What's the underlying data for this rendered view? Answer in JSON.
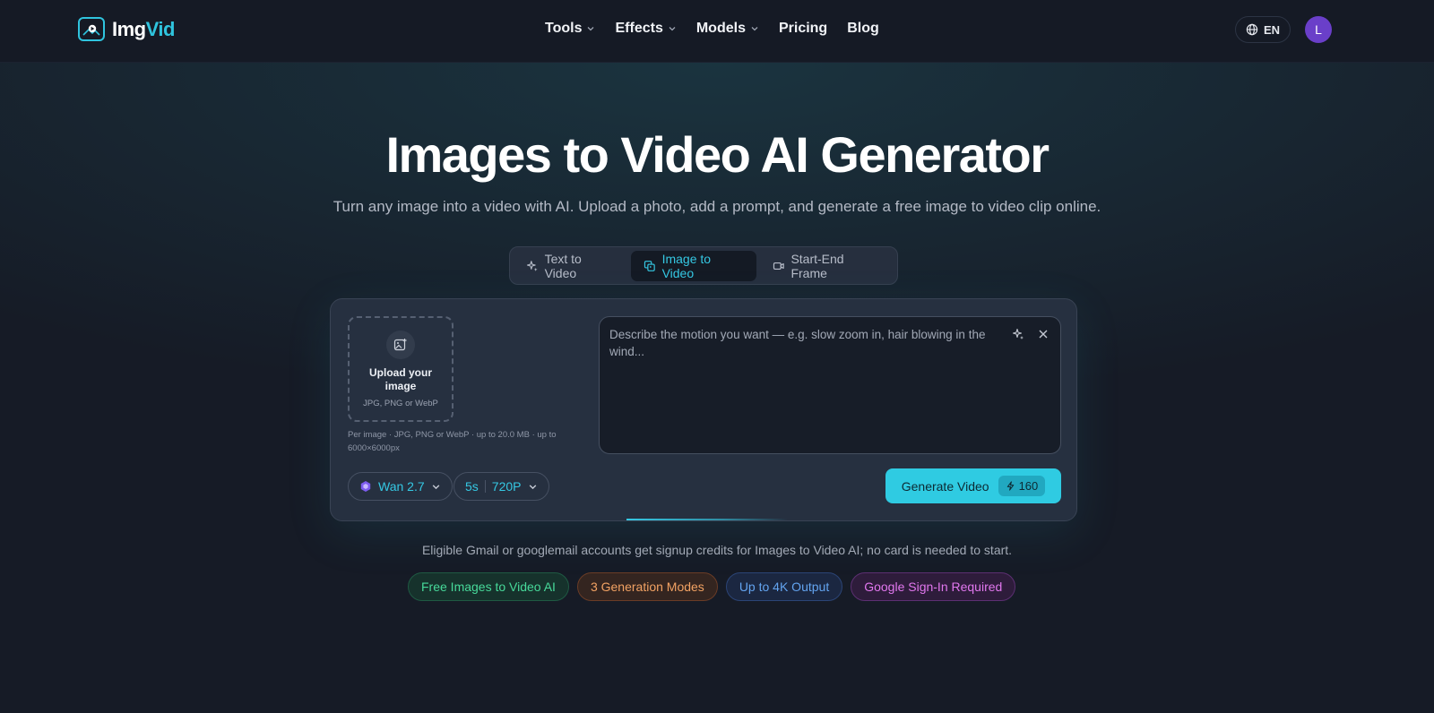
{
  "brand": {
    "name_part1": "Img",
    "name_part2": "Vid",
    "accent": "#2fc4de"
  },
  "nav": {
    "items": [
      {
        "label": "Tools",
        "has_dropdown": true
      },
      {
        "label": "Effects",
        "has_dropdown": true
      },
      {
        "label": "Models",
        "has_dropdown": true
      },
      {
        "label": "Pricing",
        "has_dropdown": false
      },
      {
        "label": "Blog",
        "has_dropdown": false
      }
    ],
    "language": "EN",
    "avatar_initial": "L"
  },
  "hero": {
    "title": "Images to Video AI Generator",
    "subtitle": "Turn any image into a video with AI. Upload a photo, add a prompt, and generate a free image to video clip online."
  },
  "modes": [
    {
      "label": "Text to Video",
      "icon": "sparkles-icon",
      "active": false
    },
    {
      "label": "Image to Video",
      "icon": "images-icon",
      "active": true
    },
    {
      "label": "Start-End Frame",
      "icon": "video-camera-icon",
      "active": false
    }
  ],
  "upload": {
    "title": "Upload your image",
    "formats": "JPG, PNG or WebP",
    "note": "Per image · JPG, PNG or WebP · up to 20.0 MB · up to 6000×6000px"
  },
  "prompt": {
    "placeholder": "Describe the motion you want — e.g. slow zoom in, hair blowing in the wind..."
  },
  "model_select": {
    "value": "Wan 2.7"
  },
  "settings_select": {
    "duration": "5s",
    "resolution": "720P"
  },
  "generate": {
    "label": "Generate Video",
    "credits": "160"
  },
  "notice": "Eligible Gmail or googlemail accounts get signup credits for Images to Video AI; no card is needed to start.",
  "badges": [
    {
      "label": "Free Images to Video AI",
      "color": "#47d99a"
    },
    {
      "label": "3 Generation Modes",
      "color": "#f2a263"
    },
    {
      "label": "Up to 4K Output",
      "color": "#63a4f0"
    },
    {
      "label": "Google Sign-In Required",
      "color": "#e177ee"
    }
  ]
}
